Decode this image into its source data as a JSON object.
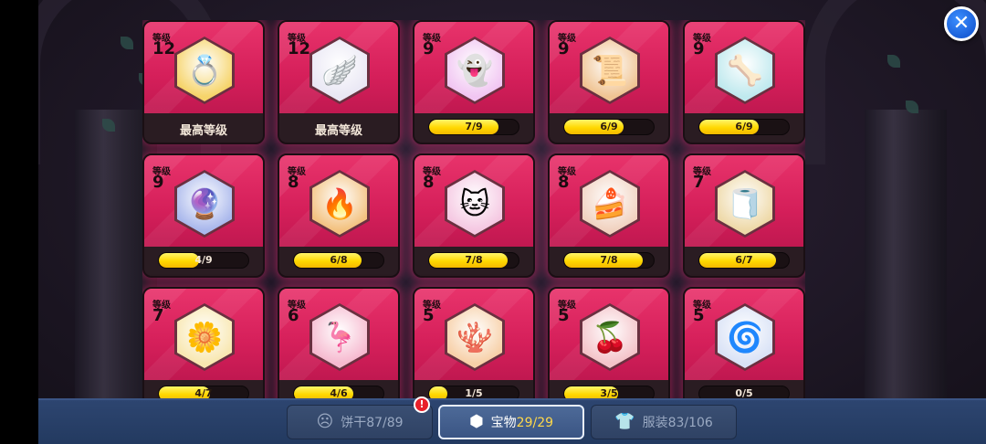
{
  "level_label": "等级",
  "max_level_text": "最高等级",
  "colors": {
    "card_glow": "#e6286e",
    "bar_fill": "#ffd800",
    "nav_bg": "#2d4570",
    "accent_count": "#ffd84a"
  },
  "treasures": [
    {
      "level": "12",
      "max": true,
      "icon": "golden-ring-treasure-icon",
      "glyph": "💍",
      "bg": "#f6d46a"
    },
    {
      "level": "12",
      "max": true,
      "icon": "silver-wing-treasure-icon",
      "glyph": "🪽",
      "bg": "#e9e7f4"
    },
    {
      "level": "9",
      "max": false,
      "progress": "7/9",
      "fill": 0.778,
      "icon": "pink-spirit-treasure-icon",
      "glyph": "👻",
      "bg": "#f1c6f2"
    },
    {
      "level": "9",
      "max": false,
      "progress": "6/9",
      "fill": 0.667,
      "icon": "scroll-treasure-icon",
      "glyph": "📜",
      "bg": "#f0c493"
    },
    {
      "level": "9",
      "max": false,
      "progress": "6/9",
      "fill": 0.667,
      "icon": "crystal-branch-treasure-icon",
      "glyph": "🦴",
      "bg": "#bfe9ee"
    },
    {
      "level": "9",
      "max": false,
      "progress": "4/9",
      "fill": 0.444,
      "icon": "blue-orb-treasure-icon",
      "glyph": "🔮",
      "bg": "#aab8ec"
    },
    {
      "level": "8",
      "max": false,
      "progress": "6/8",
      "fill": 0.75,
      "icon": "flame-crown-treasure-icon",
      "glyph": "🔥",
      "bg": "#f3c280"
    },
    {
      "level": "8",
      "max": false,
      "progress": "7/8",
      "fill": 0.875,
      "icon": "cat-balloon-treasure-icon",
      "glyph": "🐱",
      "bg": "#f5c8e2"
    },
    {
      "level": "8",
      "max": false,
      "progress": "7/8",
      "fill": 0.875,
      "icon": "chocolate-cake-treasure-icon",
      "glyph": "🍰",
      "bg": "#f1d2c0"
    },
    {
      "level": "7",
      "max": false,
      "progress": "6/7",
      "fill": 0.857,
      "icon": "mummy-treasure-icon",
      "glyph": "🧻",
      "bg": "#eed9a8"
    },
    {
      "level": "7",
      "max": false,
      "progress": "4/7",
      "fill": 0.571,
      "icon": "flower-wreath-treasure-icon",
      "glyph": "🌼",
      "bg": "#f8e7b0"
    },
    {
      "level": "6",
      "max": false,
      "progress": "4/6",
      "fill": 0.667,
      "icon": "flamingo-treasure-icon",
      "glyph": "🦩",
      "bg": "#f6b9cf"
    },
    {
      "level": "5",
      "max": false,
      "progress": "1/5",
      "fill": 0.2,
      "icon": "coral-treasure-icon",
      "glyph": "🪸",
      "bg": "#f7d0a8"
    },
    {
      "level": "5",
      "max": false,
      "progress": "3/5",
      "fill": 0.6,
      "icon": "berry-bouquet-treasure-icon",
      "glyph": "🍒",
      "bg": "#f4c3c9"
    },
    {
      "level": "5",
      "max": false,
      "progress": "0/5",
      "fill": 0,
      "icon": "swirl-mask-treasure-icon",
      "glyph": "🌀",
      "bg": "#d9e2f6"
    }
  ],
  "tabs": [
    {
      "label": "饼干",
      "count": "87/89",
      "icon": "cookie-face-icon",
      "glyph": "☹",
      "active": false,
      "badge": "!"
    },
    {
      "label": "宝物",
      "count": "29/29",
      "icon": "hexagon-gem-icon",
      "glyph": "⬢",
      "active": true
    },
    {
      "label": "服装",
      "count": "83/106",
      "icon": "shirt-icon",
      "glyph": "👕",
      "active": false
    }
  ],
  "close_glyph": "✕"
}
